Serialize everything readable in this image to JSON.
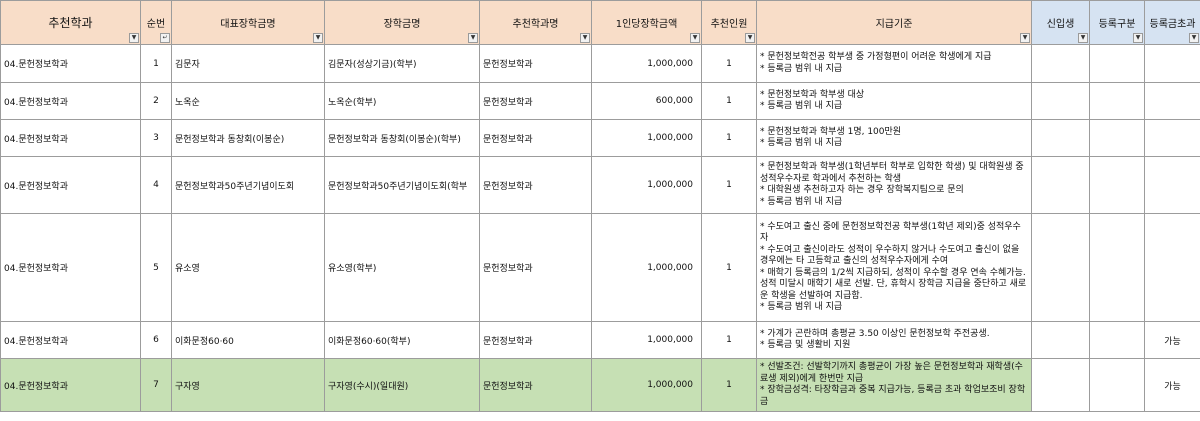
{
  "headers": [
    {
      "label": "추천학과",
      "filter": "filter-active"
    },
    {
      "label": "순번",
      "filter": "sort"
    },
    {
      "label": "대표장학금명",
      "filter": "dropdown"
    },
    {
      "label": "장학금명",
      "filter": "dropdown"
    },
    {
      "label": "추천학과명",
      "filter": "dropdown"
    },
    {
      "label": "1인당장학금액",
      "filter": "dropdown"
    },
    {
      "label": "추천인원",
      "filter": "dropdown"
    },
    {
      "label": "지급기준",
      "filter": "dropdown"
    },
    {
      "label": "신입생",
      "filter": "dropdown"
    },
    {
      "label": "등록구분",
      "filter": "dropdown"
    },
    {
      "label": "등록금초과",
      "filter": "dropdown"
    }
  ],
  "colors": {
    "header": "#f8ddc8",
    "header_blue": "#d6e3f2",
    "highlight_row": "#c6e0b4",
    "grid": "#9c9c9c"
  },
  "rows": [
    {
      "dept": "04.문헌정보학과",
      "no": "1",
      "rep": "김문자",
      "name": "김문자(성상기금)(학부)",
      "dept_name": "문헌정보학과",
      "amount": "1,000,000",
      "count": "1",
      "criteria": [
        "* 문헌정보학전공 학부생 중 가정형편이 어려운 학생에게 지급",
        "* 등록금 범위 내 지급"
      ],
      "freshman": "",
      "reg": "",
      "over": ""
    },
    {
      "dept": "04.문헌정보학과",
      "no": "2",
      "rep": "노옥순",
      "name": "노옥순(학부)",
      "dept_name": "문헌정보학과",
      "amount": "600,000",
      "count": "1",
      "criteria": [
        "* 문헌정보학과 학부생 대상",
        "* 등록금 범위 내 지급"
      ],
      "freshman": "",
      "reg": "",
      "over": ""
    },
    {
      "dept": "04.문헌정보학과",
      "no": "3",
      "rep": "문헌정보학과 동창회(이봉순)",
      "name": "문헌정보학과 동창회(이봉순)(학부)",
      "dept_name": "문헌정보학과",
      "amount": "1,000,000",
      "count": "1",
      "criteria": [
        "* 문헌정보학과 학부생 1명, 100만원",
        "* 등록금 범위 내 지급"
      ],
      "freshman": "",
      "reg": "",
      "over": ""
    },
    {
      "dept": "04.문헌정보학과",
      "no": "4",
      "rep": "문헌정보학과50주년기념이도회",
      "name": "문헌정보학과50주년기념이도회(학부",
      "dept_name": "문헌정보학과",
      "amount": "1,000,000",
      "count": "1",
      "criteria": [
        "* 문헌정보학과 학부생(1학년부터 학부로 입학한 학생) 및 대학원생 중 성적우수자로 학과에서 추천하는 학생",
        "* 대학원생 추천하고자 하는 경우 장학복지팀으로 문의",
        "* 등록금 범위 내 지급"
      ],
      "freshman": "",
      "reg": "",
      "over": ""
    },
    {
      "dept": "04.문헌정보학과",
      "no": "5",
      "rep": "유소영",
      "name": "유소영(학부)",
      "dept_name": "문헌정보학과",
      "amount": "1,000,000",
      "count": "1",
      "criteria": [
        "* 수도여고 출신 중에 문헌정보학전공 학부생(1학년 제외)중 성적우수자",
        "* 수도여고 출신이라도 성적이 우수하지 않거나 수도여고 출신이 없을 경우에는 타 고등학교 출신의 성적우수자에게 수여",
        "* 매학기 등록금의 1/2씩 지급하되, 성적이 우수할 경우 연속 수혜가능. 성적 미달시 매학기 새로 선발. 단, 휴학시 장학금 지급을 중단하고 새로운 학생을 선발하여 지급함.",
        "* 등록금 범위 내 지급"
      ],
      "freshman": "",
      "reg": "",
      "over": ""
    },
    {
      "dept": "04.문헌정보학과",
      "no": "6",
      "rep": "이화문정60·60",
      "name": "이화문정60·60(학부)",
      "dept_name": "문헌정보학과",
      "amount": "1,000,000",
      "count": "1",
      "criteria": [
        "* 가계가 곤란하며 총평균 3.50 이상인 문헌정보학 주전공생.",
        "* 등록금 및 생활비 지원"
      ],
      "freshman": "",
      "reg": "",
      "over": "가능"
    },
    {
      "dept": "04.문헌정보학과",
      "no": "7",
      "rep": "구자영",
      "name": "구자영(수시)(일대원)",
      "dept_name": "문헌정보학과",
      "amount": "1,000,000",
      "count": "1",
      "criteria": [
        "* 선발조건: 선발학기까지 총평균이 가장 높은 문헌정보학과 재학생(수료생 제외)에게 한번만 지급",
        "* 장학금성격: 타장학금과 중복 지급가능, 등록금 초과 학업보조비 장학금"
      ],
      "freshman": "",
      "reg": "",
      "over": "가능",
      "highlight": true
    }
  ]
}
